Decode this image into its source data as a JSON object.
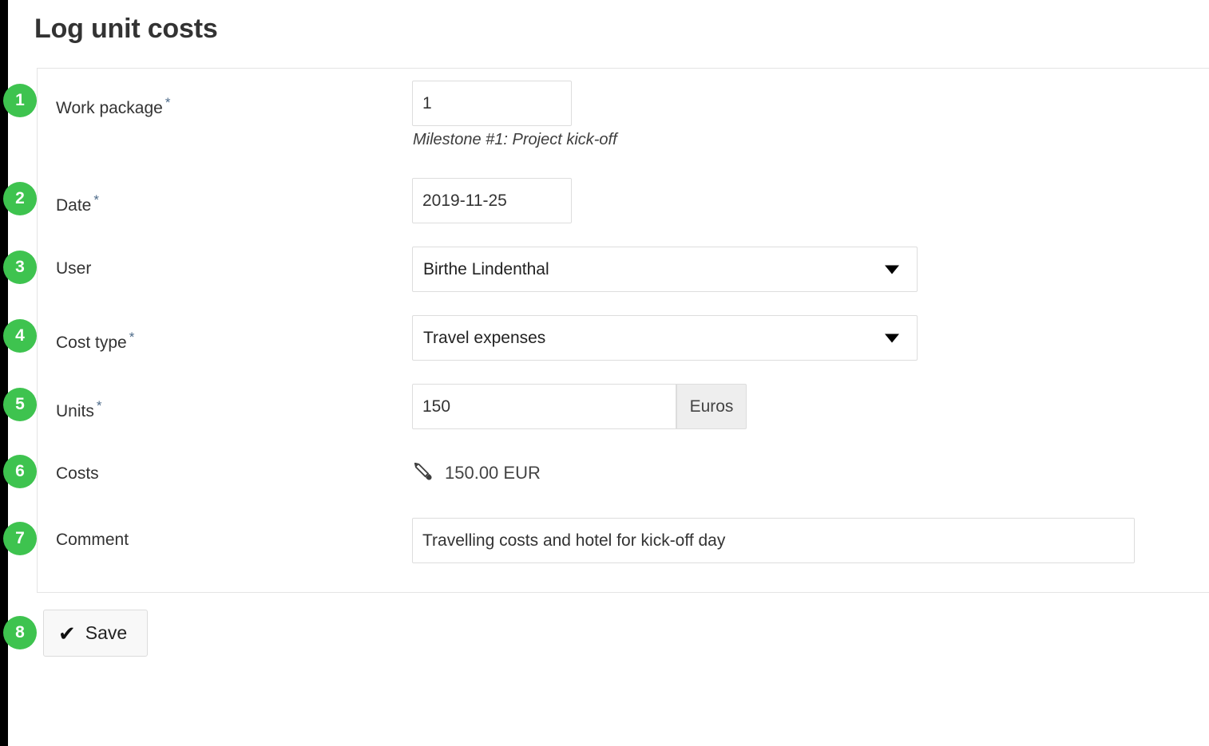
{
  "page": {
    "title": "Log unit costs"
  },
  "theme": {
    "badge_green": "#3ec34f",
    "required_marker": "#4d6b8a",
    "border": "#dddddd",
    "addon_bg": "#eeeeee"
  },
  "form": {
    "required_symbol": "*",
    "fields": [
      {
        "badge": "1",
        "label": "Work package",
        "required": true,
        "control": "text",
        "value": "1",
        "placeholder": "",
        "hint": "Milestone #1: Project kick-off"
      },
      {
        "badge": "2",
        "label": "Date",
        "required": true,
        "control": "text",
        "value": "2019-11-25",
        "placeholder": "",
        "hint": ""
      },
      {
        "badge": "3",
        "label": "User",
        "required": false,
        "control": "select",
        "value": "Birthe Lindenthal",
        "hint": ""
      },
      {
        "badge": "4",
        "label": "Cost type",
        "required": true,
        "control": "select",
        "value": "Travel expenses",
        "hint": ""
      },
      {
        "badge": "5",
        "label": "Units",
        "required": true,
        "control": "text-addon",
        "value": "150",
        "addon": "Euros",
        "hint": ""
      },
      {
        "badge": "6",
        "label": "Costs",
        "required": false,
        "control": "readonly-editable",
        "value": "150.00 EUR",
        "icon": "pencil-icon",
        "hint": ""
      },
      {
        "badge": "7",
        "label": "Comment",
        "required": false,
        "control": "text",
        "value": "Travelling costs and hotel for kick-off day",
        "placeholder": "",
        "hint": ""
      }
    ]
  },
  "actions": {
    "badge": "8",
    "save_label": "Save",
    "save_icon": "✔"
  }
}
